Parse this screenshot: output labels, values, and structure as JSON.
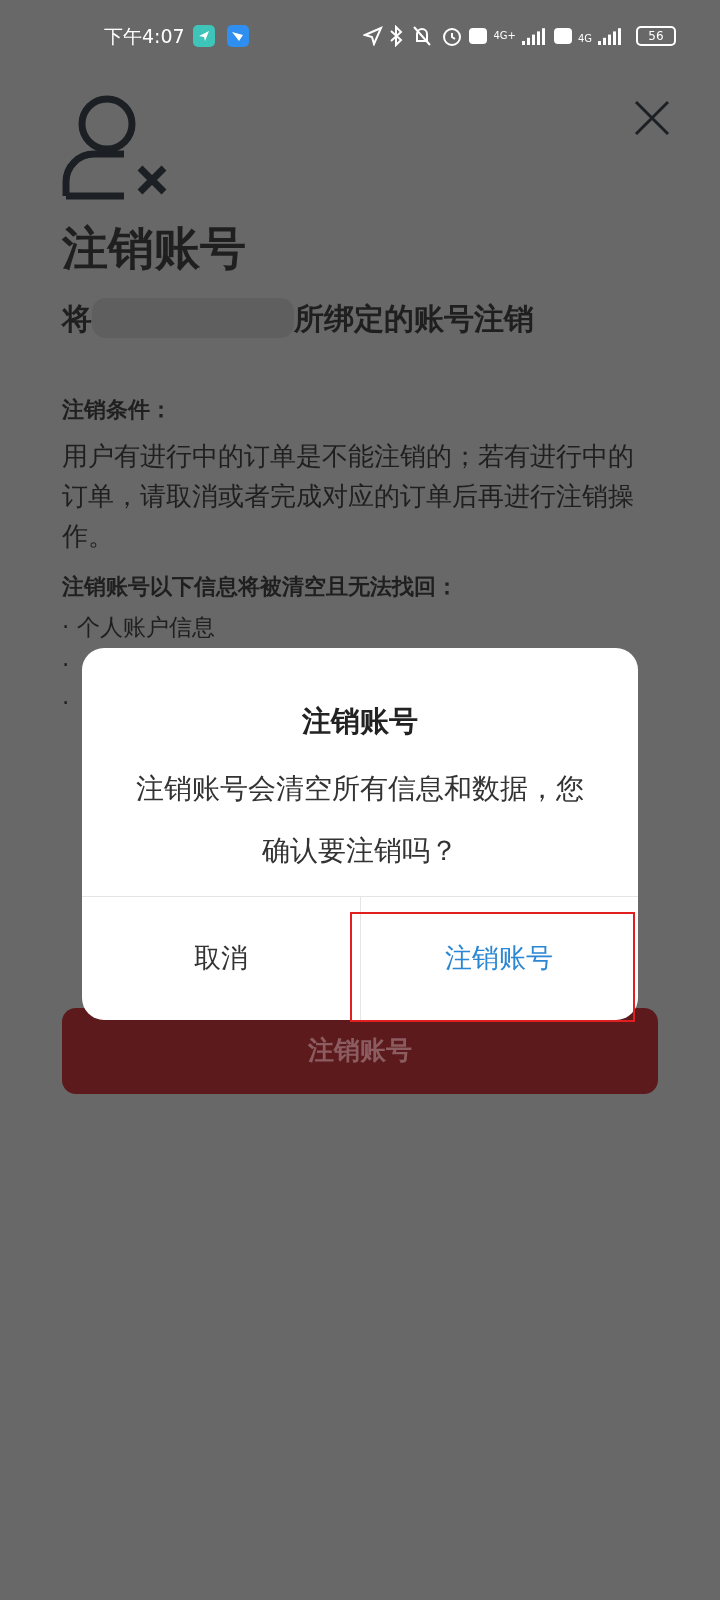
{
  "status_bar": {
    "time": "下午4:07",
    "network_1": "4G+",
    "network_2": "4G",
    "battery": "56"
  },
  "header": {
    "title": "注销账号",
    "subtitle_prefix": "将",
    "subtitle_suffix": "所绑定的账号注销"
  },
  "conditions": {
    "heading": "注销条件：",
    "text": "用户有进行中的订单是不能注销的；若有进行中的订单，请取消或者完成对应的订单后再进行注销操作。"
  },
  "cleared_info": {
    "heading": "注销账号以下信息将被清空且无法找回：",
    "items": [
      {
        "bullet": "·",
        "text": "个人账户信息"
      },
      {
        "bullet": "·"
      },
      {
        "bullet": "·"
      }
    ]
  },
  "main_button": "注销账号",
  "dialog": {
    "title": "注销账号",
    "message": "注销账号会清空所有信息和数据，您确认要注销吗？",
    "buttons": [
      {
        "label": "取消",
        "kind": "cancel"
      },
      {
        "label": "注销账号",
        "kind": "confirm"
      }
    ]
  }
}
